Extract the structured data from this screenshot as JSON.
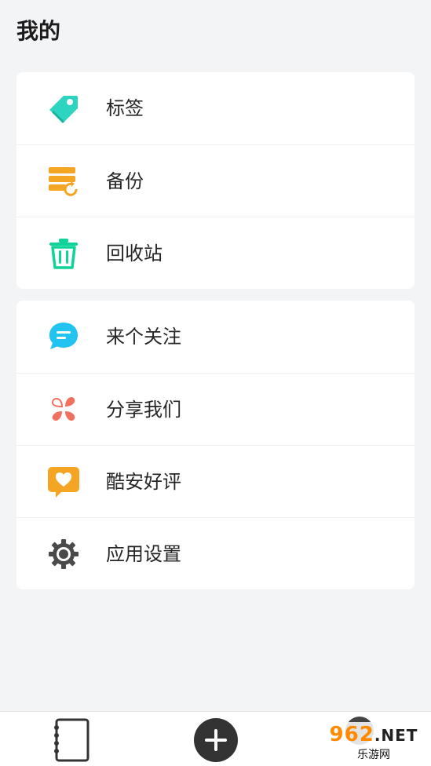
{
  "page": {
    "title": "我的"
  },
  "group1": {
    "items": [
      {
        "label": "标签",
        "icon": "tag-icon",
        "color": "#2dd4bf"
      },
      {
        "label": "备份",
        "icon": "backup-icon",
        "color": "#f5a524"
      },
      {
        "label": "回收站",
        "icon": "trash-icon",
        "color": "#10d39a"
      }
    ]
  },
  "group2": {
    "items": [
      {
        "label": "来个关注",
        "icon": "chat-bubble-icon",
        "color": "#22c3f0"
      },
      {
        "label": "分享我们",
        "icon": "share-hearts-icon",
        "color": "#f2705e"
      },
      {
        "label": "酷安好评",
        "icon": "heart-speech-icon",
        "color": "#f5a524"
      },
      {
        "label": "应用设置",
        "icon": "gear-icon",
        "color": "#4a4a4a"
      }
    ]
  },
  "bottom_nav": {
    "items": [
      {
        "icon": "notebook-icon"
      },
      {
        "icon": "add-icon"
      },
      {
        "icon": "profile-icon"
      }
    ]
  },
  "watermark": {
    "brand": "962",
    "suffix": ".NET",
    "subtitle": "乐游网"
  }
}
